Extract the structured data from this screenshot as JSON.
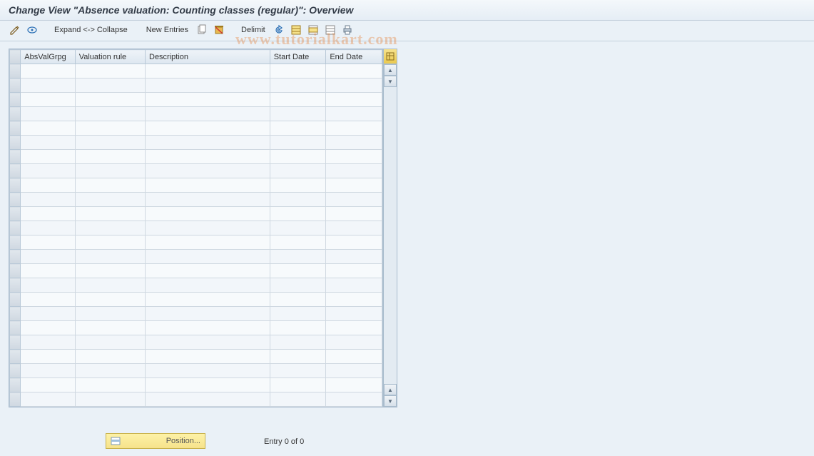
{
  "title": "Change View \"Absence valuation: Counting classes (regular)\": Overview",
  "toolbar": {
    "expand_collapse": "Expand <-> Collapse",
    "new_entries": "New Entries",
    "delimit": "Delimit"
  },
  "watermark": "www.tutorialkart.com",
  "table": {
    "columns": [
      "AbsValGrpg",
      "Valuation rule",
      "Description",
      "Start Date",
      "End Date"
    ],
    "row_count": 24
  },
  "footer": {
    "position_label": "Position...",
    "entry_text": "Entry 0 of 0"
  },
  "icons": {
    "pencil": "pencil-icon",
    "glasses": "glasses-icon",
    "copy": "copy-icon",
    "delete": "delete-icon",
    "undo": "undo-icon",
    "select_all": "select-all-icon",
    "select_block": "select-block-icon",
    "deselect": "deselect-icon",
    "config": "config-icon",
    "position": "position-icon"
  }
}
